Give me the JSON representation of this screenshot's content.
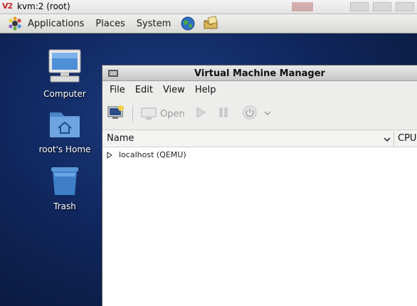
{
  "vnc": {
    "logo": "V2",
    "title": "kvm:2 (root)"
  },
  "panel": {
    "menus": [
      "Applications",
      "Places",
      "System"
    ],
    "launchers": [
      "browser-globe-icon",
      "mail-notes-icon"
    ]
  },
  "desktop": {
    "icons": [
      {
        "label": "Computer",
        "icon": "computer-icon"
      },
      {
        "label": "root's Home",
        "icon": "home-folder-icon"
      },
      {
        "label": "Trash",
        "icon": "trash-icon"
      }
    ]
  },
  "vmm": {
    "title": "Virtual Machine Manager",
    "menu": [
      "File",
      "Edit",
      "View",
      "Help"
    ],
    "toolbar": {
      "open_label": "Open"
    },
    "columns": {
      "name": "Name",
      "cpu": "CPU"
    },
    "rows": [
      {
        "label": "localhost (QEMU)"
      }
    ]
  }
}
